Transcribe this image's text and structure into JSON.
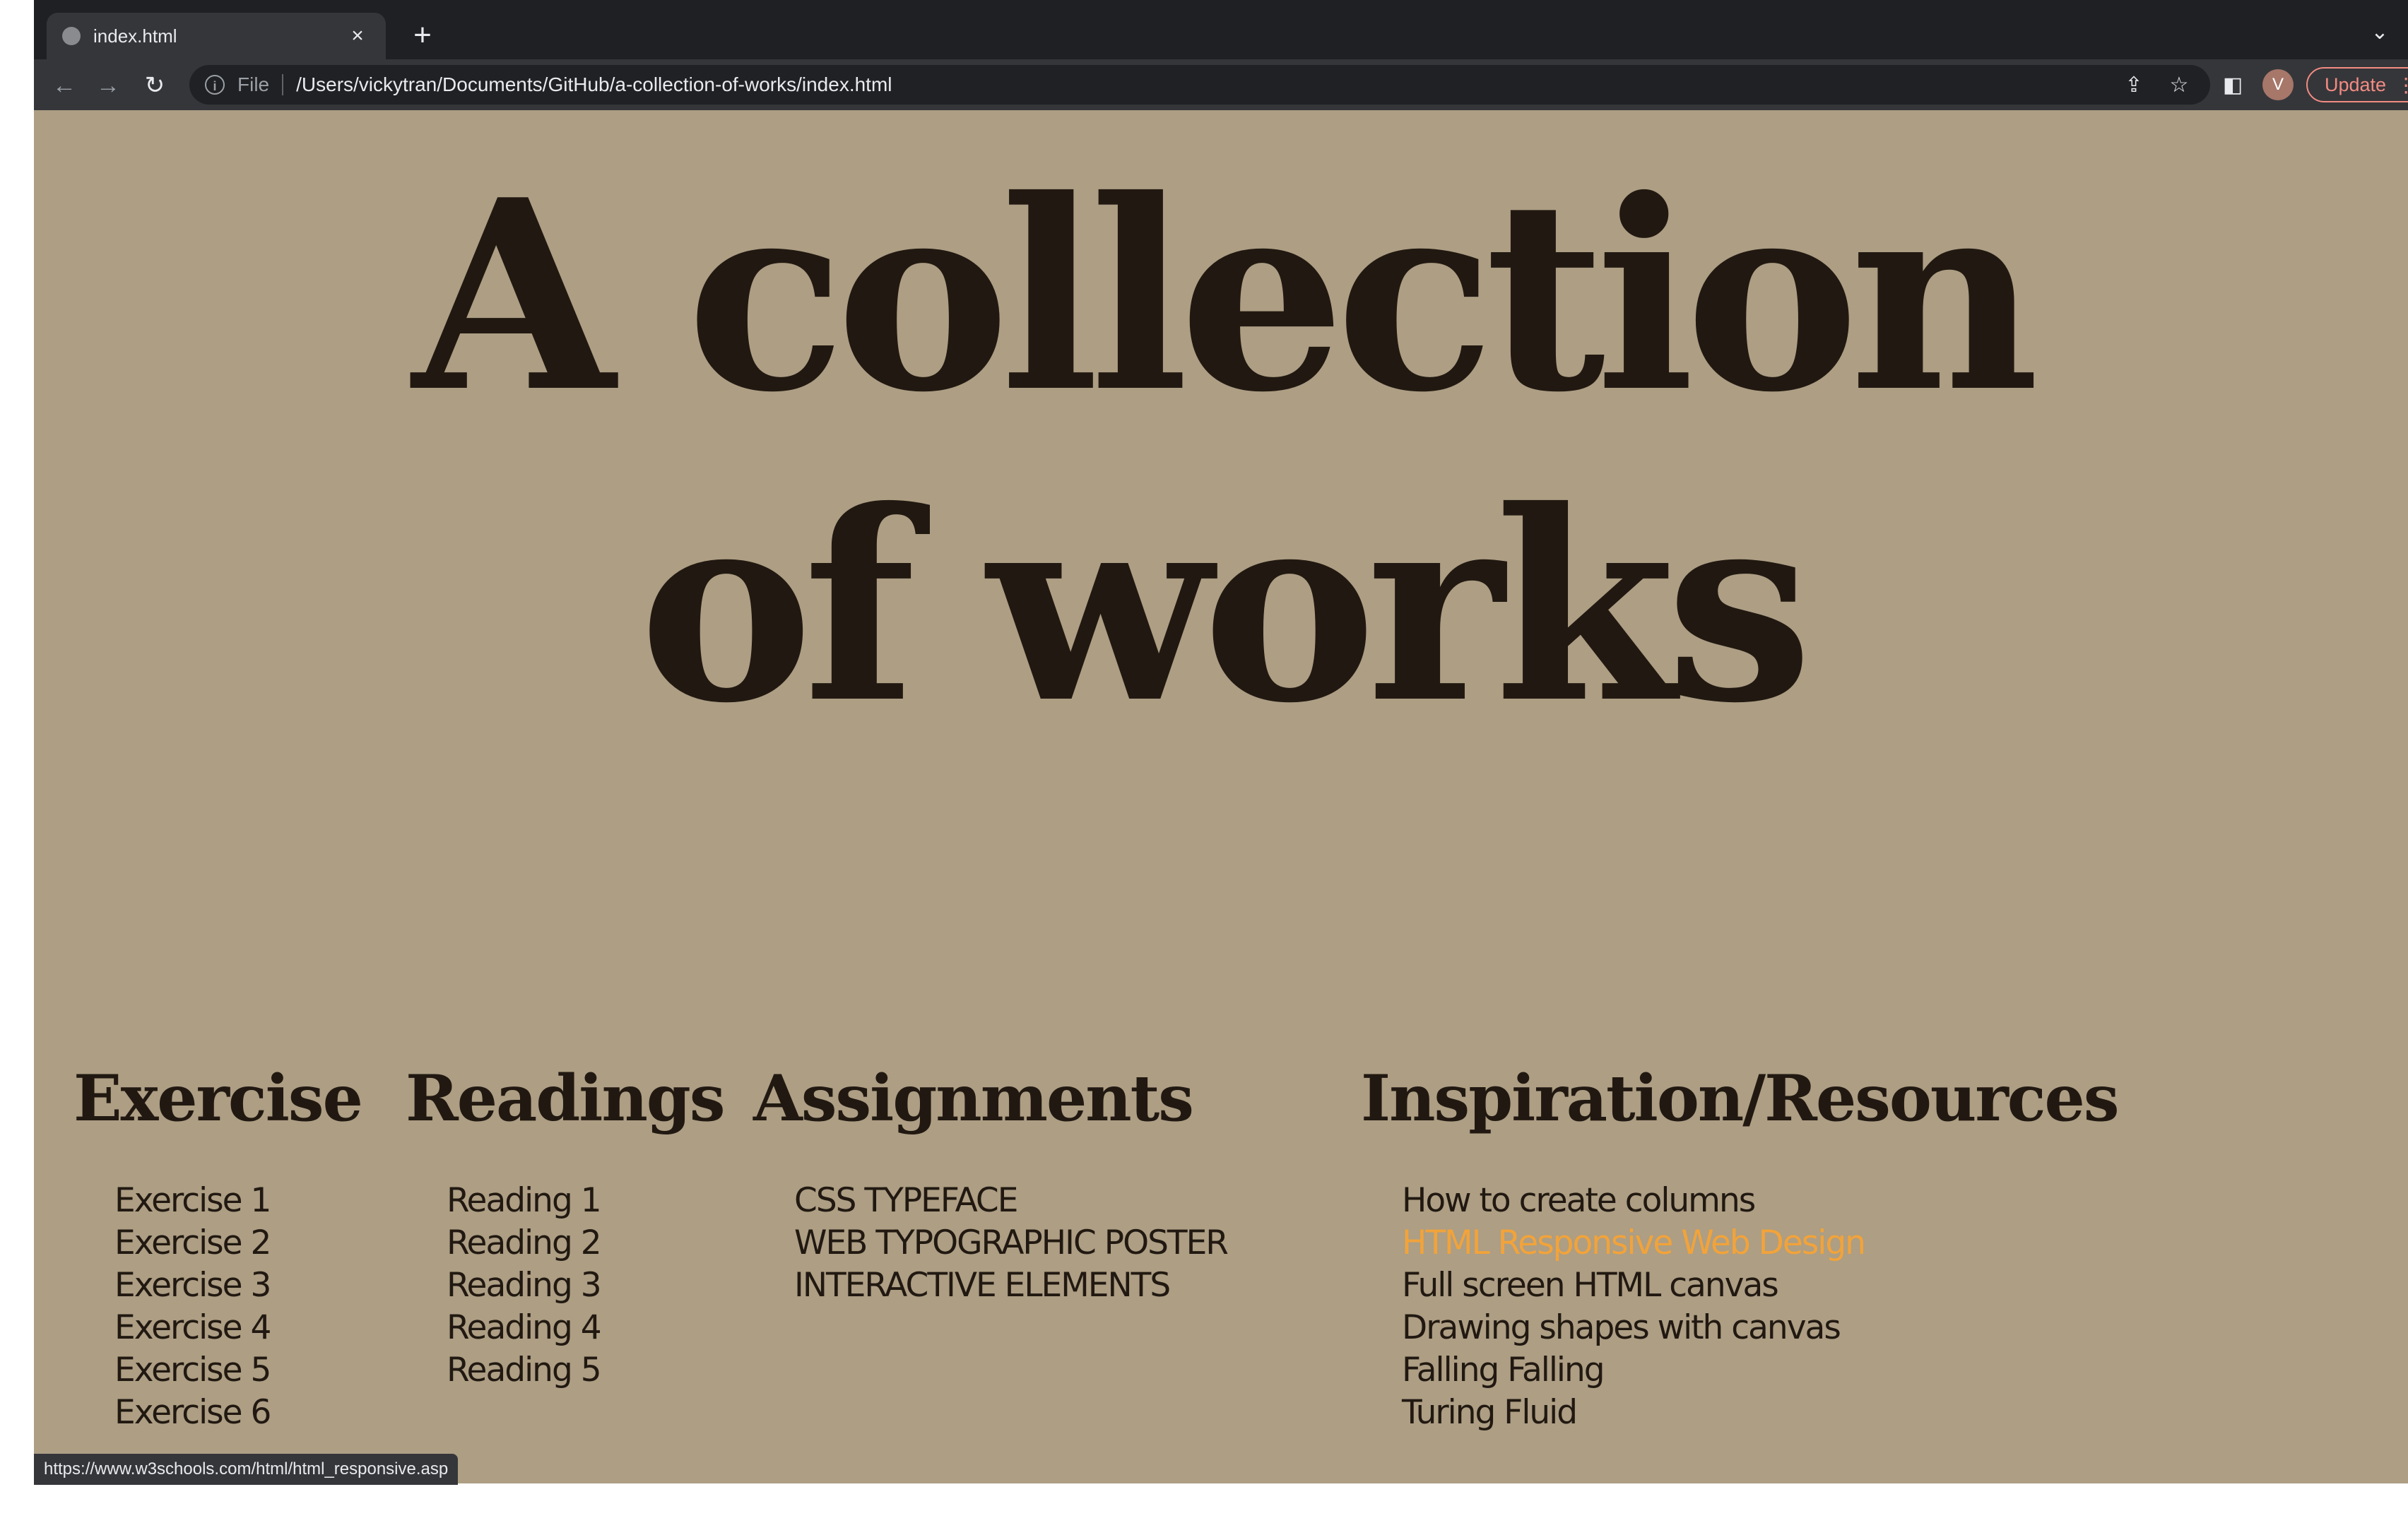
{
  "browser": {
    "tab_title": "index.html",
    "tab_close": "×",
    "new_tab": "+",
    "tab_menu": "⌄",
    "back": "←",
    "forward": "→",
    "reload": "↻",
    "info_icon": "i",
    "scheme": "File",
    "url": "/Users/vickytran/Documents/GitHub/a-collection-of-works/index.html",
    "share_icon": "⇪",
    "bookmark_icon": "☆",
    "sidepanel_icon": "◧",
    "avatar_letter": "V",
    "update_label": "Update",
    "menu_dots": "⋮",
    "status_url": "https://www.w3schools.com/html/html_responsive.asp"
  },
  "page": {
    "title_line1": "A collection",
    "title_line2": "of works",
    "columns": [
      {
        "heading": "Exercise",
        "items": [
          "Exercise 1",
          "Exercise 2",
          "Exercise 3",
          "Exercise 4",
          "Exercise 5",
          "Exercise 6"
        ]
      },
      {
        "heading": "Readings",
        "items": [
          "Reading 1",
          "Reading 2",
          "Reading 3",
          "Reading 4",
          "Reading 5"
        ]
      },
      {
        "heading": "Assignments",
        "items": [
          "CSS TYPEFACE",
          "WEB TYPOGRAPHIC POSTER",
          "INTERACTIVE ELEMENTS"
        ]
      },
      {
        "heading": "Inspiration/Resources",
        "items": [
          "How to create columns",
          "HTML Responsive Web Design",
          "Full screen HTML canvas",
          "Drawing shapes with canvas",
          "Falling Falling",
          "Turing Fluid"
        ]
      }
    ]
  },
  "colors": {
    "page_background": "#ad9e84",
    "text": "#211911",
    "hover_link": "#f2a33a"
  }
}
